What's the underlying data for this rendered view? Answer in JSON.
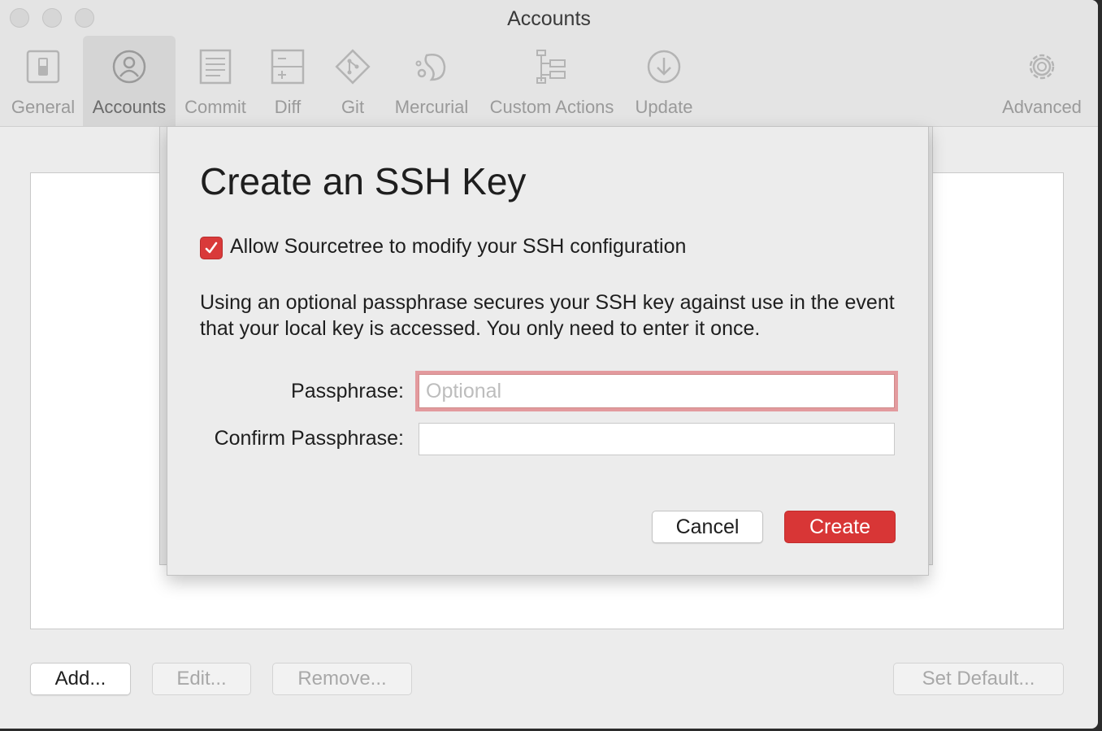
{
  "window": {
    "title": "Accounts"
  },
  "toolbar": {
    "items": [
      {
        "label": "General",
        "icon": "switch-icon",
        "selected": false
      },
      {
        "label": "Accounts",
        "icon": "person-icon",
        "selected": true
      },
      {
        "label": "Commit",
        "icon": "document-icon",
        "selected": false
      },
      {
        "label": "Diff",
        "icon": "diff-icon",
        "selected": false
      },
      {
        "label": "Git",
        "icon": "git-icon",
        "selected": false
      },
      {
        "label": "Mercurial",
        "icon": "mercurial-icon",
        "selected": false
      },
      {
        "label": "Custom Actions",
        "icon": "custom-actions-icon",
        "selected": false
      },
      {
        "label": "Update",
        "icon": "download-icon",
        "selected": false
      },
      {
        "label": "Advanced",
        "icon": "gear-icon",
        "selected": false
      }
    ]
  },
  "accounts": {
    "buttons": {
      "add": "Add...",
      "edit": "Edit...",
      "remove": "Remove...",
      "set_default": "Set Default..."
    }
  },
  "dialog": {
    "title": "Create an SSH Key",
    "checkbox": {
      "label": "Allow Sourcetree to modify your SSH configuration",
      "checked": true
    },
    "description": "Using an optional passphrase secures your SSH key against use in the event that your local key is accessed. You only need to enter it once.",
    "passphrase": {
      "label": "Passphrase:",
      "placeholder": "Optional",
      "value": ""
    },
    "confirm": {
      "label": "Confirm Passphrase:",
      "value": ""
    },
    "cancel_label": "Cancel",
    "create_label": "Create"
  },
  "colors": {
    "accent": "#d83636",
    "focus_ring": "#e39a9e",
    "window_bg": "#ececec"
  }
}
